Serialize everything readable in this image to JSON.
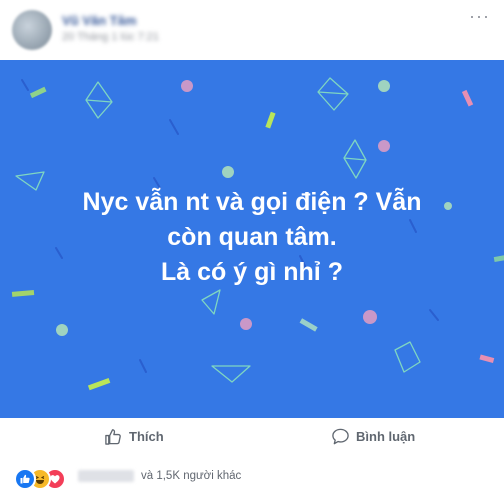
{
  "post": {
    "author": "Vũ Văn Tâm",
    "timestamp": "20 Tháng 1 lúc 7:21",
    "menu_glyph": "···",
    "text_lines": [
      "Nyc vẫn nt và gọi điện ? Vẫn",
      "còn quan tâm.",
      "Là có ý gì nhỉ ?"
    ],
    "background_color": "#3578e5"
  },
  "actions": {
    "like_label": "Thích",
    "comment_label": "Bình luận"
  },
  "reactions": {
    "types": [
      "like",
      "haha",
      "love"
    ],
    "others_text": "và 1,5K người khác"
  },
  "colors": {
    "link_blue": "#365899",
    "action_text": "#606770",
    "like_blue": "#1877f2",
    "haha_yellow": "#f7b928",
    "love_red": "#f33e58"
  }
}
